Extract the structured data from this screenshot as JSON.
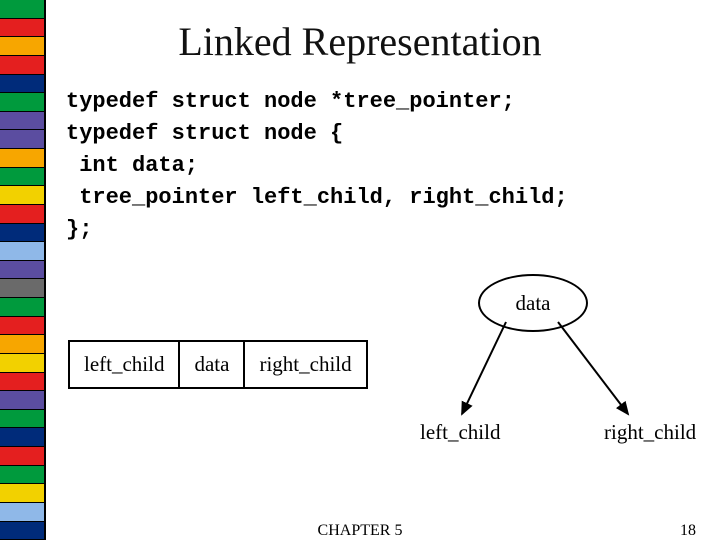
{
  "title": "Linked Representation",
  "code": {
    "l1": "typedef struct node *tree_pointer;",
    "l2": "typedef struct node {",
    "l3": " int data;",
    "l4": " tree_pointer left_child, right_child;",
    "l5": "};"
  },
  "table": {
    "c1": "left_child",
    "c2": "data",
    "c3": "right_child"
  },
  "diagram": {
    "node": "data",
    "left": "left_child",
    "right": "right_child"
  },
  "footer": {
    "chapter": "CHAPTER 5",
    "page": "18"
  },
  "stripe_colors": [
    "#009a3d",
    "#e41f1f",
    "#f7a600",
    "#e41f1f",
    "#002b7a",
    "#009a3d",
    "#5b4da0",
    "#5b4da0",
    "#f7a600",
    "#009a3d",
    "#f2d100",
    "#e41f1f",
    "#002b7a",
    "#8fb8e8",
    "#5b4da0",
    "#6a6a6a",
    "#009a3d",
    "#e41f1f",
    "#f7a600",
    "#f2d100",
    "#e41f1f",
    "#5b4da0",
    "#009a3d",
    "#002b7a",
    "#e41f1f",
    "#009a3d",
    "#f2d100",
    "#8fb8e8",
    "#002b7a"
  ]
}
